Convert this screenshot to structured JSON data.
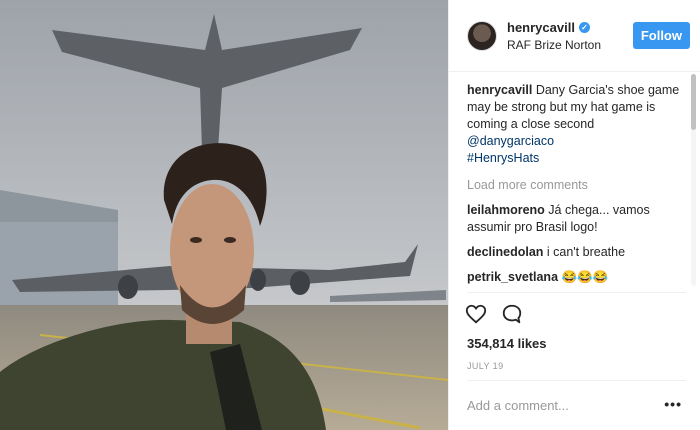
{
  "header": {
    "username": "henrycavill",
    "location": "RAF Brize Norton",
    "follow_label": "Follow",
    "verified_glyph": "✓"
  },
  "caption": {
    "username": "henrycavill",
    "text": "Dany Garcia's shoe game may be strong but my hat game is coming a close second",
    "mention": "@danygarciaco",
    "hashtag": "#HenrysHats"
  },
  "load_more_label": "Load more comments",
  "comments": [
    {
      "username": "leilahmoreno",
      "text": "Já chega... vamos assumir pro Brasil logo!"
    },
    {
      "username": "declinedolan",
      "text": "i can't breathe"
    },
    {
      "username": "petrik_svetlana",
      "text": "😂😂😂"
    }
  ],
  "likes": "354,814 likes",
  "date": "JULY 19",
  "add_comment_placeholder": "Add a comment...",
  "options_glyph": "•••",
  "colors": {
    "accent": "#3897f0",
    "link": "#003569",
    "muted": "#999999"
  },
  "icons": [
    "heart-icon",
    "comment-bubble-icon",
    "verified-badge-icon",
    "more-options-icon"
  ]
}
